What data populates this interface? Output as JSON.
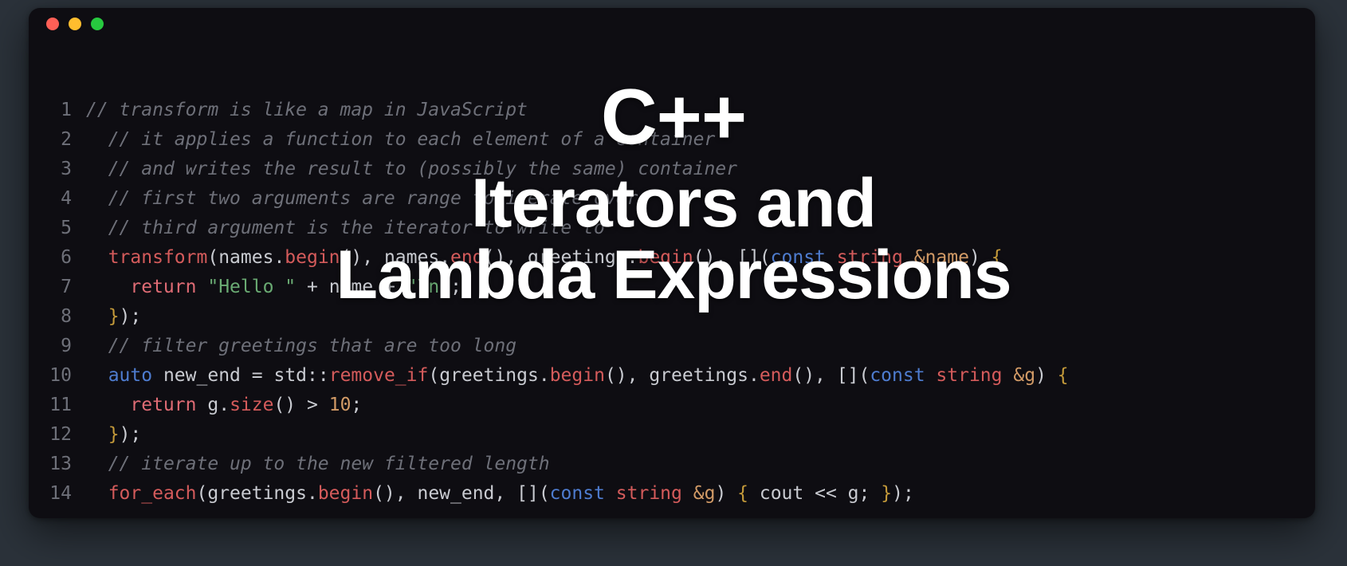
{
  "overlay": {
    "title": "C++",
    "subtitle1": "Iterators and",
    "subtitle2": "Lambda Expressions"
  },
  "window": {
    "controls": [
      "close",
      "minimize",
      "zoom"
    ]
  },
  "code": {
    "lines": [
      {
        "n": 1,
        "indent": "",
        "tokens": [
          {
            "c": "tok-comment",
            "t": "// transform is like a map in JavaScript"
          }
        ]
      },
      {
        "n": 2,
        "indent": "  ",
        "tokens": [
          {
            "c": "tok-comment",
            "t": "// it applies a function to each element of a container"
          }
        ]
      },
      {
        "n": 3,
        "indent": "  ",
        "tokens": [
          {
            "c": "tok-comment",
            "t": "// and writes the result to (possibly the same) container"
          }
        ]
      },
      {
        "n": 4,
        "indent": "  ",
        "tokens": [
          {
            "c": "tok-comment",
            "t": "// first two arguments are range to iterate over"
          }
        ]
      },
      {
        "n": 5,
        "indent": "  ",
        "tokens": [
          {
            "c": "tok-comment",
            "t": "// third argument is the iterator to write to"
          }
        ]
      },
      {
        "n": 6,
        "indent": "  ",
        "tokens": [
          {
            "c": "tok-fn",
            "t": "transform"
          },
          {
            "c": "tok-punct",
            "t": "("
          },
          {
            "c": "tok-ident",
            "t": "names"
          },
          {
            "c": "tok-punct",
            "t": "."
          },
          {
            "c": "tok-fn",
            "t": "begin"
          },
          {
            "c": "tok-punct",
            "t": "(), "
          },
          {
            "c": "tok-ident",
            "t": "names"
          },
          {
            "c": "tok-punct",
            "t": "."
          },
          {
            "c": "tok-fn",
            "t": "end"
          },
          {
            "c": "tok-punct",
            "t": "(), "
          },
          {
            "c": "tok-ident",
            "t": "greetings"
          },
          {
            "c": "tok-punct",
            "t": "."
          },
          {
            "c": "tok-fn",
            "t": "begin"
          },
          {
            "c": "tok-punct",
            "t": "(), "
          },
          {
            "c": "tok-bracket",
            "t": "[]"
          },
          {
            "c": "tok-punct",
            "t": "("
          },
          {
            "c": "tok-kw2",
            "t": "const"
          },
          {
            "c": "tok-punct",
            "t": " "
          },
          {
            "c": "tok-type",
            "t": "string"
          },
          {
            "c": "tok-punct",
            "t": " "
          },
          {
            "c": "tok-param",
            "t": "&name"
          },
          {
            "c": "tok-punct",
            "t": ") "
          },
          {
            "c": "tok-brace",
            "t": "{"
          }
        ]
      },
      {
        "n": 7,
        "indent": "    ",
        "tokens": [
          {
            "c": "tok-kw",
            "t": "return"
          },
          {
            "c": "tok-punct",
            "t": " "
          },
          {
            "c": "tok-str",
            "t": "\"Hello \""
          },
          {
            "c": "tok-punct",
            "t": " "
          },
          {
            "c": "tok-op",
            "t": "+"
          },
          {
            "c": "tok-punct",
            "t": " "
          },
          {
            "c": "tok-ident",
            "t": "name"
          },
          {
            "c": "tok-punct",
            "t": " "
          },
          {
            "c": "tok-op",
            "t": "+"
          },
          {
            "c": "tok-punct",
            "t": " "
          },
          {
            "c": "tok-str",
            "t": "\"\\n\""
          },
          {
            "c": "tok-punct",
            "t": ";"
          }
        ]
      },
      {
        "n": 8,
        "indent": "  ",
        "tokens": [
          {
            "c": "tok-brace",
            "t": "}"
          },
          {
            "c": "tok-punct",
            "t": ");"
          }
        ]
      },
      {
        "n": 9,
        "indent": "  ",
        "tokens": [
          {
            "c": "tok-comment",
            "t": "// filter greetings that are too long"
          }
        ]
      },
      {
        "n": 10,
        "indent": "  ",
        "tokens": [
          {
            "c": "tok-kw2",
            "t": "auto"
          },
          {
            "c": "tok-punct",
            "t": " "
          },
          {
            "c": "tok-ident",
            "t": "new_end"
          },
          {
            "c": "tok-punct",
            "t": " "
          },
          {
            "c": "tok-op",
            "t": "="
          },
          {
            "c": "tok-punct",
            "t": " "
          },
          {
            "c": "tok-ident",
            "t": "std"
          },
          {
            "c": "tok-punct",
            "t": "::"
          },
          {
            "c": "tok-fn",
            "t": "remove_if"
          },
          {
            "c": "tok-punct",
            "t": "("
          },
          {
            "c": "tok-ident",
            "t": "greetings"
          },
          {
            "c": "tok-punct",
            "t": "."
          },
          {
            "c": "tok-fn",
            "t": "begin"
          },
          {
            "c": "tok-punct",
            "t": "(), "
          },
          {
            "c": "tok-ident",
            "t": "greetings"
          },
          {
            "c": "tok-punct",
            "t": "."
          },
          {
            "c": "tok-fn",
            "t": "end"
          },
          {
            "c": "tok-punct",
            "t": "(), "
          },
          {
            "c": "tok-bracket",
            "t": "[]"
          },
          {
            "c": "tok-punct",
            "t": "("
          },
          {
            "c": "tok-kw2",
            "t": "const"
          },
          {
            "c": "tok-punct",
            "t": " "
          },
          {
            "c": "tok-type",
            "t": "string"
          },
          {
            "c": "tok-punct",
            "t": " "
          },
          {
            "c": "tok-param",
            "t": "&g"
          },
          {
            "c": "tok-punct",
            "t": ") "
          },
          {
            "c": "tok-brace",
            "t": "{"
          }
        ]
      },
      {
        "n": 11,
        "indent": "    ",
        "tokens": [
          {
            "c": "tok-kw",
            "t": "return"
          },
          {
            "c": "tok-punct",
            "t": " "
          },
          {
            "c": "tok-ident",
            "t": "g"
          },
          {
            "c": "tok-punct",
            "t": "."
          },
          {
            "c": "tok-fn",
            "t": "size"
          },
          {
            "c": "tok-punct",
            "t": "() "
          },
          {
            "c": "tok-op",
            "t": ">"
          },
          {
            "c": "tok-punct",
            "t": " "
          },
          {
            "c": "tok-num",
            "t": "10"
          },
          {
            "c": "tok-punct",
            "t": ";"
          }
        ]
      },
      {
        "n": 12,
        "indent": "  ",
        "tokens": [
          {
            "c": "tok-brace",
            "t": "}"
          },
          {
            "c": "tok-punct",
            "t": ");"
          }
        ]
      },
      {
        "n": 13,
        "indent": "  ",
        "tokens": [
          {
            "c": "tok-comment",
            "t": "// iterate up to the new filtered length"
          }
        ]
      },
      {
        "n": 14,
        "indent": "  ",
        "tokens": [
          {
            "c": "tok-fn",
            "t": "for_each"
          },
          {
            "c": "tok-punct",
            "t": "("
          },
          {
            "c": "tok-ident",
            "t": "greetings"
          },
          {
            "c": "tok-punct",
            "t": "."
          },
          {
            "c": "tok-fn",
            "t": "begin"
          },
          {
            "c": "tok-punct",
            "t": "(), "
          },
          {
            "c": "tok-ident",
            "t": "new_end"
          },
          {
            "c": "tok-punct",
            "t": ", "
          },
          {
            "c": "tok-bracket",
            "t": "[]"
          },
          {
            "c": "tok-punct",
            "t": "("
          },
          {
            "c": "tok-kw2",
            "t": "const"
          },
          {
            "c": "tok-punct",
            "t": " "
          },
          {
            "c": "tok-type",
            "t": "string"
          },
          {
            "c": "tok-punct",
            "t": " "
          },
          {
            "c": "tok-param",
            "t": "&g"
          },
          {
            "c": "tok-punct",
            "t": ") "
          },
          {
            "c": "tok-brace",
            "t": "{"
          },
          {
            "c": "tok-punct",
            "t": " "
          },
          {
            "c": "tok-ident",
            "t": "cout"
          },
          {
            "c": "tok-punct",
            "t": " "
          },
          {
            "c": "tok-op",
            "t": "<<"
          },
          {
            "c": "tok-punct",
            "t": " "
          },
          {
            "c": "tok-ident",
            "t": "g"
          },
          {
            "c": "tok-punct",
            "t": "; "
          },
          {
            "c": "tok-brace",
            "t": "}"
          },
          {
            "c": "tok-punct",
            "t": ");"
          }
        ]
      }
    ]
  }
}
